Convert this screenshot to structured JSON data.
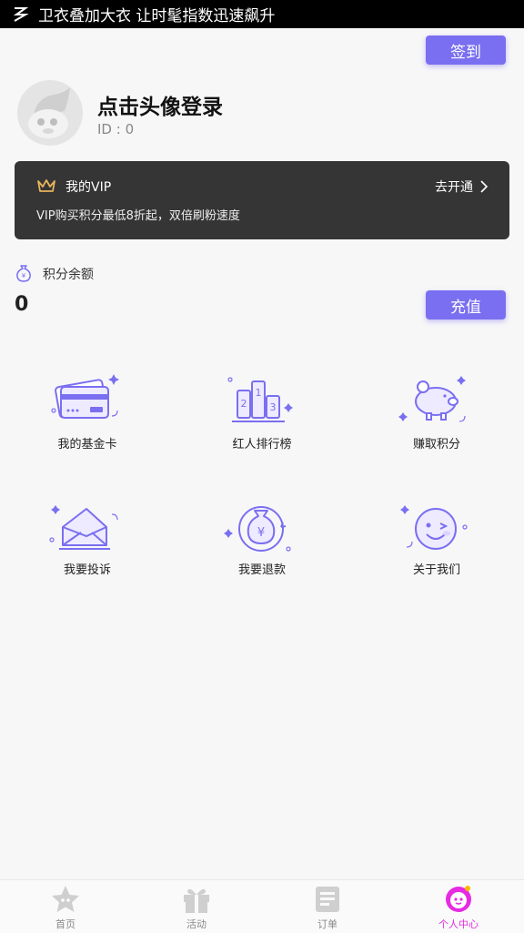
{
  "status_bar": {
    "text": "卫衣叠加大衣 让时髦指数迅速飙升"
  },
  "header": {
    "checkin_label": "签到",
    "login_title": "点击头像登录",
    "user_id": "ID : 0"
  },
  "vip": {
    "title": "我的VIP",
    "open_label": "去开通",
    "description": "VIP购买积分最低8折起，双倍刷粉速度"
  },
  "points": {
    "label": "积分余额",
    "value": "0",
    "recharge_label": "充值"
  },
  "grid": [
    {
      "label": "我的基金卡",
      "icon": "fund-card-icon"
    },
    {
      "label": "红人排行榜",
      "icon": "ranking-podium-icon"
    },
    {
      "label": "赚取积分",
      "icon": "piggy-bank-icon"
    },
    {
      "label": "我要投诉",
      "icon": "complaint-envelope-icon"
    },
    {
      "label": "我要退款",
      "icon": "refund-money-bag-icon"
    },
    {
      "label": "关于我们",
      "icon": "smiley-face-icon"
    }
  ],
  "tabs": [
    {
      "label": "首页",
      "icon": "home-star-icon",
      "active": false
    },
    {
      "label": "活动",
      "icon": "gift-icon",
      "active": false
    },
    {
      "label": "订单",
      "icon": "receipt-icon",
      "active": false
    },
    {
      "label": "个人中心",
      "icon": "profile-mascot-icon",
      "active": true
    }
  ],
  "colors": {
    "accent": "#7a6ff0",
    "vip_bg": "#353535",
    "active_tab": "#e62be3"
  }
}
